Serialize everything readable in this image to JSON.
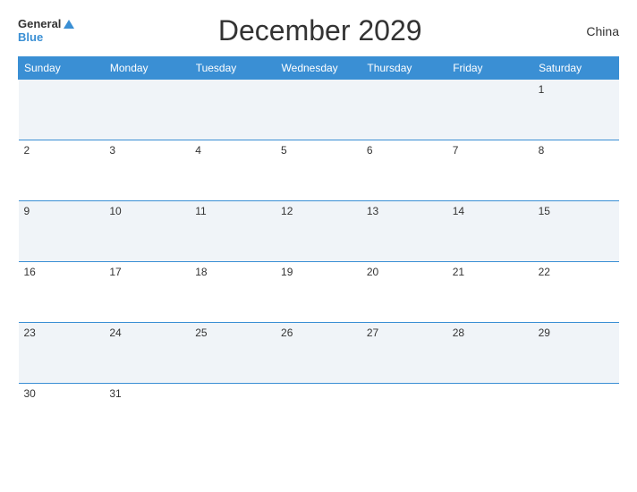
{
  "header": {
    "logo_top": "General",
    "logo_bottom": "Blue",
    "title": "December 2029",
    "country": "China"
  },
  "calendar": {
    "days_of_week": [
      "Sunday",
      "Monday",
      "Tuesday",
      "Wednesday",
      "Thursday",
      "Friday",
      "Saturday"
    ],
    "weeks": [
      [
        "",
        "",
        "",
        "",
        "",
        "",
        "1"
      ],
      [
        "2",
        "3",
        "4",
        "5",
        "6",
        "7",
        "8"
      ],
      [
        "9",
        "10",
        "11",
        "12",
        "13",
        "14",
        "15"
      ],
      [
        "16",
        "17",
        "18",
        "19",
        "20",
        "21",
        "22"
      ],
      [
        "23",
        "24",
        "25",
        "26",
        "27",
        "28",
        "29"
      ],
      [
        "30",
        "31",
        "",
        "",
        "",
        "",
        ""
      ]
    ]
  }
}
